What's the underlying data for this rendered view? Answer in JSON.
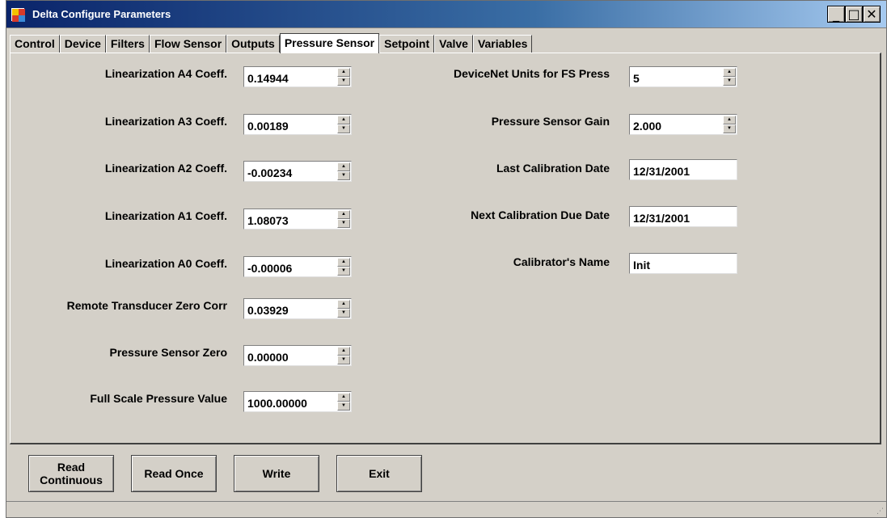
{
  "window": {
    "title": "Delta Configure Parameters",
    "min_label": "_",
    "max_label": "□",
    "close_label": "✕"
  },
  "tabs": [
    {
      "label": "Control"
    },
    {
      "label": "Device"
    },
    {
      "label": "Filters"
    },
    {
      "label": "Flow Sensor"
    },
    {
      "label": "Outputs"
    },
    {
      "label": "Pressure Sensor",
      "active": true
    },
    {
      "label": "Setpoint"
    },
    {
      "label": "Valve"
    },
    {
      "label": "Variables"
    }
  ],
  "left_fields": [
    {
      "label": "Linearization A4 Coeff.",
      "value": "0.14944"
    },
    {
      "label": "Linearization A3 Coeff.",
      "value": "0.00189"
    },
    {
      "label": "Linearization A2 Coeff.",
      "value": "-0.00234"
    },
    {
      "label": "Linearization A1 Coeff.",
      "value": "1.08073"
    },
    {
      "label": "Linearization A0 Coeff.",
      "value": "-0.00006"
    },
    {
      "label": "Remote Transducer Zero Corr",
      "value": "0.03929"
    },
    {
      "label": "Pressure Sensor Zero",
      "value": "0.00000"
    },
    {
      "label": "Full Scale Pressure Value",
      "value": "1000.00000"
    }
  ],
  "right_fields": [
    {
      "label": "DeviceNet Units for FS Press",
      "value": "5",
      "control": "spin"
    },
    {
      "label": "Pressure Sensor Gain",
      "value": "2.000",
      "control": "spin"
    },
    {
      "label": "Last Calibration Date",
      "value": "12/31/2001",
      "control": "text"
    },
    {
      "label": "Next Calibration Due Date",
      "value": "12/31/2001",
      "control": "text"
    },
    {
      "label": "Calibrator's Name",
      "value": "Init",
      "control": "text"
    }
  ],
  "buttons": {
    "read_continuous_line1": "Read",
    "read_continuous_line2": "Continuous",
    "read_once": "Read Once",
    "write": "Write",
    "exit": "Exit"
  },
  "icons": {
    "spin_up": "▲",
    "spin_down": "▼",
    "size_grip": "⋰"
  }
}
